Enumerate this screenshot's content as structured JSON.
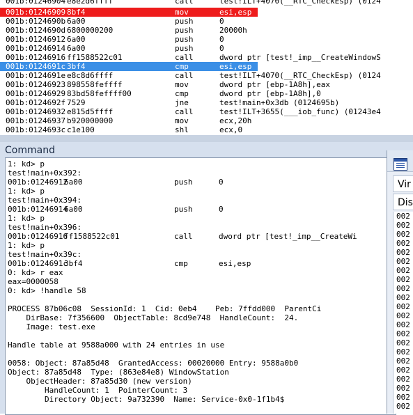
{
  "disassembly": [
    {
      "addr": "001b:01246904",
      "bytes": "e8e2d6ffff",
      "mnemonic": "call",
      "operands": "test!ILT+4070(__RTC_CheckEsp) (0124",
      "state": "normal"
    },
    {
      "addr": "001b:01246909",
      "bytes": "8bf4",
      "mnemonic": "mov",
      "operands": "esi,esp",
      "state": "breakpoint"
    },
    {
      "addr": "001b:0124690b",
      "bytes": "6a00",
      "mnemonic": "push",
      "operands": "0",
      "state": "normal"
    },
    {
      "addr": "001b:0124690d",
      "bytes": "6800000200",
      "mnemonic": "push",
      "operands": "20000h",
      "state": "normal"
    },
    {
      "addr": "001b:01246912",
      "bytes": "6a00",
      "mnemonic": "push",
      "operands": "0",
      "state": "normal"
    },
    {
      "addr": "001b:01246914",
      "bytes": "6a00",
      "mnemonic": "push",
      "operands": "0",
      "state": "normal"
    },
    {
      "addr": "001b:01246916",
      "bytes": "ff1588522c01",
      "mnemonic": "call",
      "operands": "dword ptr [test!_imp__CreateWindowS",
      "state": "normal"
    },
    {
      "addr": "001b:0124691c",
      "bytes": "3bf4",
      "mnemonic": "cmp",
      "operands": "esi,esp",
      "state": "current"
    },
    {
      "addr": "001b:0124691e",
      "bytes": "e8c8d6ffff",
      "mnemonic": "call",
      "operands": "test!ILT+4070(__RTC_CheckEsp) (0124",
      "state": "normal"
    },
    {
      "addr": "001b:01246923",
      "bytes": "898558feffff",
      "mnemonic": "mov",
      "operands": "dword ptr [ebp-1A8h],eax",
      "state": "normal"
    },
    {
      "addr": "001b:01246929",
      "bytes": "83bd58feffff00",
      "mnemonic": "cmp",
      "operands": "dword ptr [ebp-1A8h],0",
      "state": "normal"
    },
    {
      "addr": "001b:0124692f",
      "bytes": "7529",
      "mnemonic": "jne",
      "operands": "test!main+0x3db (0124695b)",
      "state": "normal"
    },
    {
      "addr": "001b:01246932",
      "bytes": "e815d5ffff",
      "mnemonic": "call",
      "operands": "test!ILT+3655(___iob_func) (01243e4",
      "state": "normal"
    },
    {
      "addr": "001b:01246937",
      "bytes": "b920000000",
      "mnemonic": "mov",
      "operands": "ecx,20h",
      "state": "normal"
    },
    {
      "addr": "001b:0124693c",
      "bytes": "c1e100",
      "mnemonic": "shl",
      "operands": "ecx,0",
      "state": "normal"
    }
  ],
  "command": {
    "title": "Command",
    "lines": [
      {
        "text": "1: kd> p"
      },
      {
        "text": "test!main+0x392:"
      },
      {
        "addr": "001b:01246912",
        "bytes": "6a00",
        "mnemonic": "push",
        "operands": "0"
      },
      {
        "text": "1: kd> p"
      },
      {
        "text": "test!main+0x394:"
      },
      {
        "addr": "001b:01246914",
        "bytes": "6a00",
        "mnemonic": "push",
        "operands": "0"
      },
      {
        "text": "1: kd> p"
      },
      {
        "text": "test!main+0x396:"
      },
      {
        "addr": "001b:01246916",
        "bytes": "ff1588522c01",
        "mnemonic": "call",
        "operands": "dword ptr [test!_imp__CreateWi"
      },
      {
        "text": "1: kd> p"
      },
      {
        "text": "test!main+0x39c:"
      },
      {
        "addr": "001b:0124691c",
        "bytes": "3bf4",
        "mnemonic": "cmp",
        "operands": "esi,esp"
      },
      {
        "text": "0: kd> r eax"
      },
      {
        "text": "eax=0000058"
      },
      {
        "text": "0: kd> !handle 58"
      },
      {
        "text": ""
      },
      {
        "text": "PROCESS 87b06c08  SessionId: 1  Cid: 0eb4    Peb: 7ffdd000  ParentCi"
      },
      {
        "text": "    DirBase: 7f356600  ObjectTable: 8cd9e748  HandleCount:  24."
      },
      {
        "text": "    Image: test.exe"
      },
      {
        "text": ""
      },
      {
        "text": "Handle table at 9588a000 with 24 entries in use"
      },
      {
        "text": ""
      },
      {
        "text": "0058: Object: 87a85d48  GrantedAccess: 00020000 Entry: 9588a0b0"
      },
      {
        "text": "Object: 87a85d48  Type: (863e84e8) WindowStation"
      },
      {
        "text": "    ObjectHeader: 87a85d30 (new version)"
      },
      {
        "text": "        HandleCount: 1  PointerCount: 3"
      },
      {
        "text": "        Directory Object: 9a732390  Name: Service-0x0-1f1b4$"
      }
    ]
  },
  "side_panel": {
    "tab1": "Vir",
    "tab2": "Dis",
    "list": [
      "002",
      "002",
      "002",
      "002",
      "002",
      "002",
      "002",
      "002",
      "002",
      "002",
      "002",
      "002",
      "002",
      "002",
      "002",
      "002",
      "002",
      "002",
      "002",
      "002",
      "002",
      "002"
    ]
  },
  "colors": {
    "breakpoint": "#ee1c1c",
    "current_line": "#3b8fe6",
    "window_frame": "#d6e0ee"
  }
}
